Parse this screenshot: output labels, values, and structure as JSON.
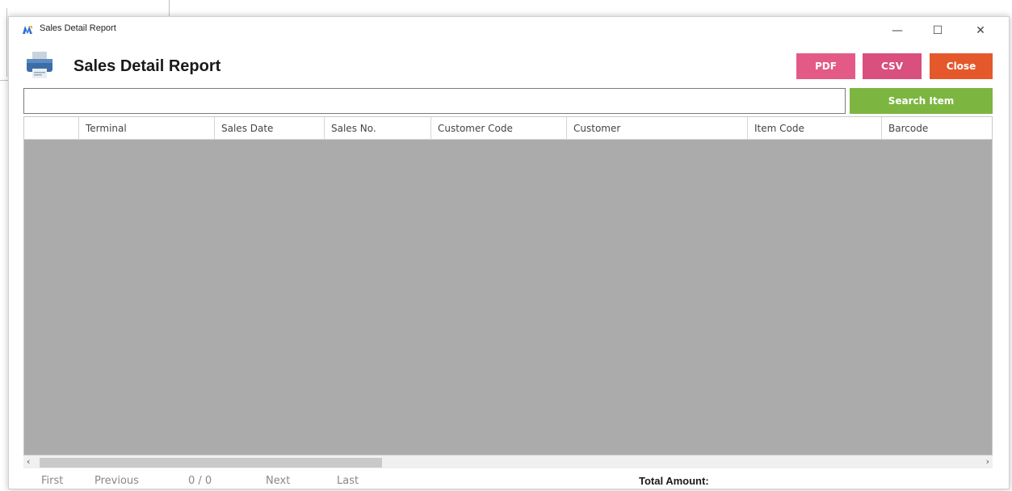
{
  "window": {
    "title": "Sales Detail Report",
    "minimize_glyph": "—",
    "maximize_glyph": "☐",
    "close_glyph": "✕"
  },
  "header": {
    "title": "Sales Detail Report",
    "icon": "printer-icon"
  },
  "toolbar": {
    "pdf_label": "PDF",
    "csv_label": "CSV",
    "close_label": "Close",
    "pdf_color": "#e35a87",
    "csv_color": "#d94f7e",
    "close_color": "#e5582c"
  },
  "search": {
    "value": "",
    "button_label": "Search Item",
    "button_color": "#7cb640"
  },
  "grid": {
    "columns": [
      "",
      "Terminal",
      "Sales Date",
      "Sales No.",
      "Customer Code",
      "Customer",
      "Item Code",
      "Barcode"
    ],
    "rows": []
  },
  "scrollbar": {
    "left_arrow": "‹",
    "right_arrow": "›"
  },
  "pager": {
    "first": "First",
    "previous": "Previous",
    "count": "0 / 0",
    "next": "Next",
    "last": "Last"
  },
  "totals": {
    "label": "Total Amount:",
    "value": ""
  }
}
